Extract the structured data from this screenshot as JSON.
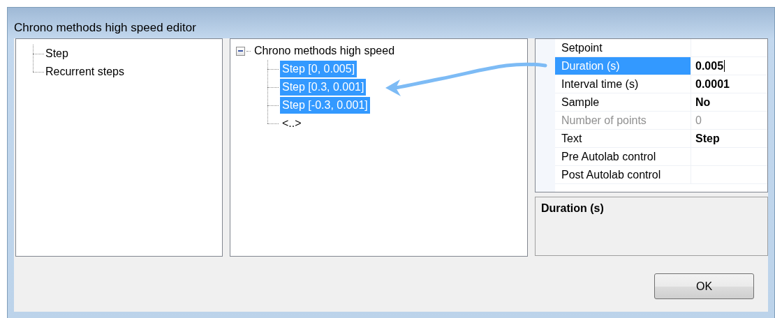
{
  "window": {
    "title": "Chrono methods high speed editor"
  },
  "library": {
    "items": [
      {
        "label": "Step"
      },
      {
        "label": "Recurrent steps"
      }
    ]
  },
  "method_tree": {
    "label": "Chrono methods high speed",
    "expanded": true,
    "children": [
      {
        "label": "Step [0, 0.005]",
        "selected": true
      },
      {
        "label": "Step [0.3, 0.001]",
        "selected": true
      },
      {
        "label": "Step [-0.3, 0.001]",
        "selected": true
      },
      {
        "label": "<..>",
        "selected": false
      }
    ]
  },
  "properties": [
    {
      "label": "Setpoint",
      "selected": false,
      "disabled": false
    },
    {
      "label": "Duration (s)",
      "value": "0.005",
      "selected": true,
      "disabled": false
    },
    {
      "label": "Interval time (s)",
      "value": "0.0001",
      "selected": false,
      "disabled": false
    },
    {
      "label": "Sample",
      "value": "No",
      "selected": false,
      "disabled": false
    },
    {
      "label": "Number of points",
      "value": "0",
      "selected": false,
      "disabled": true
    },
    {
      "label": "Text",
      "value": "Step",
      "selected": false,
      "disabled": false
    },
    {
      "label": "Pre Autolab control",
      "selected": false,
      "disabled": false
    },
    {
      "label": "Post Autolab control",
      "selected": false,
      "disabled": false
    }
  ],
  "description": {
    "title": "Duration (s)"
  },
  "buttons": [
    {
      "label": "OK"
    }
  ]
}
